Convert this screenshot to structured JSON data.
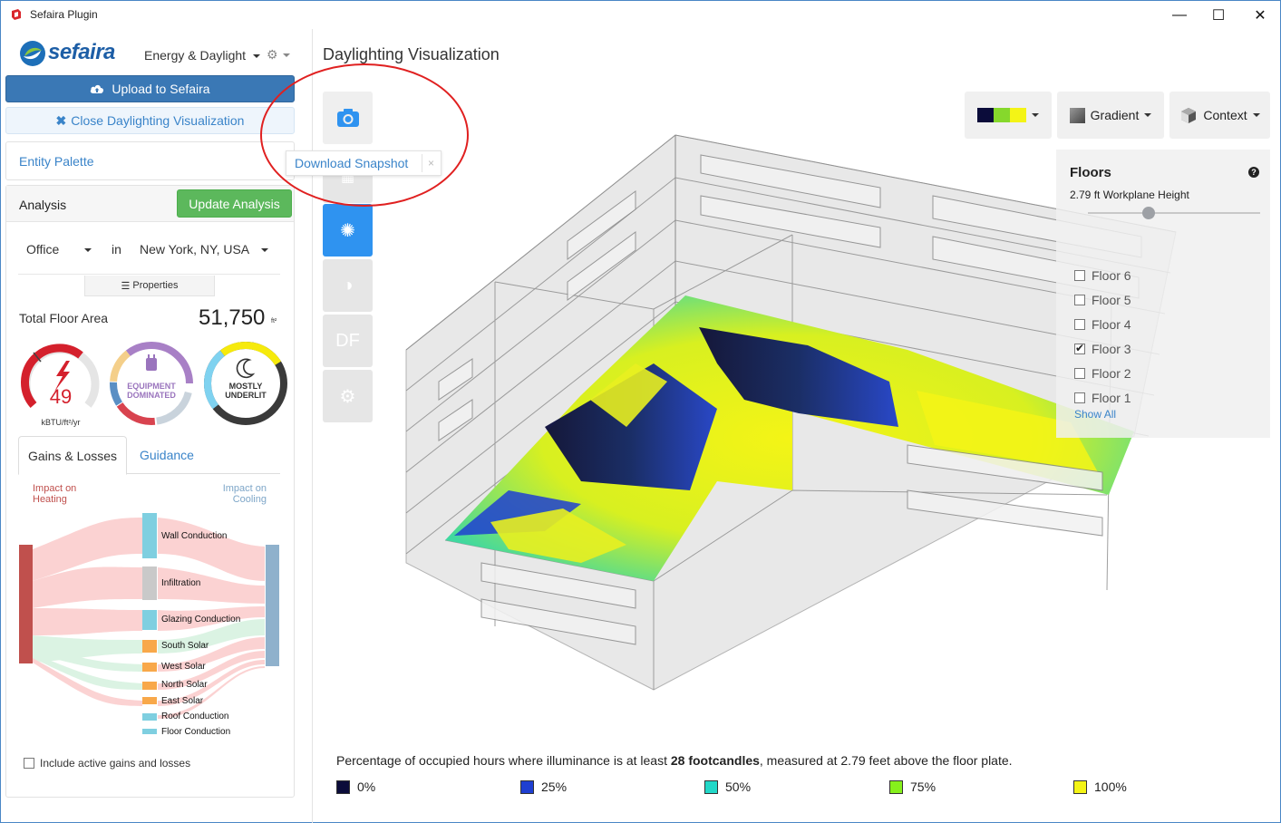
{
  "window": {
    "title": "Sefaira Plugin",
    "controls": {
      "minimize": "—",
      "maximize": "☐",
      "close": "✕"
    }
  },
  "header": {
    "logo_text": "sefaira",
    "mode_label": "Energy & Daylight"
  },
  "buttons": {
    "upload": "Upload to Sefaira",
    "close_viz": "Close Daylighting Visualization",
    "update": "Update Analysis"
  },
  "entity_palette": "Entity Palette",
  "analysis": {
    "title": "Analysis",
    "building_type": "Office",
    "in_label": "in",
    "location": "New York, NY, USA",
    "properties_label": "Properties",
    "total_floor_area_label": "Total Floor Area",
    "total_floor_area_value": "51,750",
    "total_floor_area_unit": "ft²",
    "gauges": {
      "eui_value": "49",
      "eui_unit": "kBTU/ft²/yr",
      "equipment_line1": "EQUIPMENT",
      "equipment_line2": "DOMINATED",
      "underlit_line1": "MOSTLY",
      "underlit_line2": "UNDERLIT"
    },
    "tabs": [
      "Gains & Losses",
      "Guidance"
    ],
    "impact_heating": [
      "Impact on",
      "Heating"
    ],
    "impact_cooling": [
      "Impact on",
      "Cooling"
    ],
    "sankey_items": [
      "Wall Conduction",
      "Infiltration",
      "Glazing Conduction",
      "South Solar",
      "West Solar",
      "North Solar",
      "East Solar",
      "Roof Conduction",
      "Floor Conduction"
    ],
    "include_label": "Include active gains and losses"
  },
  "main": {
    "title": "Daylighting Visualization",
    "tooltip": "Download Snapshot",
    "tooltip_close": "×",
    "tool_df": "DF",
    "toolbar": {
      "gradient": "Gradient",
      "context": "Context"
    },
    "floors": {
      "title": "Floors",
      "help": "?",
      "workplane": "2.79 ft Workplane Height",
      "slider_value": 0.35,
      "items": [
        {
          "label": "Floor 6",
          "checked": false
        },
        {
          "label": "Floor 5",
          "checked": false
        },
        {
          "label": "Floor 4",
          "checked": false
        },
        {
          "label": "Floor 3",
          "checked": true
        },
        {
          "label": "Floor 2",
          "checked": false
        },
        {
          "label": "Floor 1",
          "checked": false
        }
      ],
      "show_all": "Show All"
    },
    "legend": {
      "text_before": "Percentage of occupied hours where illuminance is at least ",
      "text_bold": "28 footcandles",
      "text_after": ", measured at 2.79 feet above the floor plate.",
      "items": [
        {
          "label": "0%",
          "color": "#0b0c3a"
        },
        {
          "label": "25%",
          "color": "#1f3fd1"
        },
        {
          "label": "50%",
          "color": "#22d8c8"
        },
        {
          "label": "75%",
          "color": "#86f01c"
        },
        {
          "label": "100%",
          "color": "#f4f416"
        }
      ]
    }
  },
  "colors": {
    "accent_blue": "#3a84c9",
    "upload_blue": "#3a78b5",
    "green": "#5cb85c",
    "tool_active": "#2f93f0",
    "annotation_red": "#e02020"
  }
}
